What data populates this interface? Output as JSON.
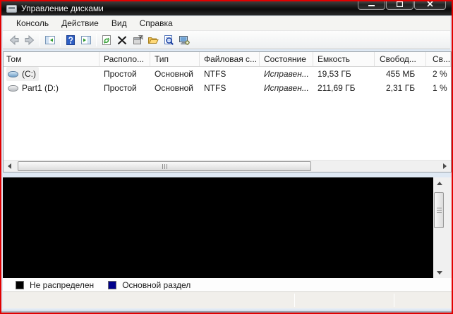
{
  "window": {
    "title": "Управление дисками",
    "border_color": "#e10000"
  },
  "menubar": {
    "items": [
      "Консоль",
      "Действие",
      "Вид",
      "Справка"
    ]
  },
  "toolbar": {
    "icons": [
      "back-icon",
      "forward-icon",
      "show-console-tree-icon",
      "help-icon",
      "show-action-pane-icon",
      "refresh-icon",
      "delete-icon",
      "properties-icon",
      "open-folder-icon",
      "search-icon",
      "manage-computer-icon"
    ]
  },
  "volume_list": {
    "columns": [
      "Том",
      "Располо...",
      "Тип",
      "Файловая с...",
      "Состояние",
      "Емкость",
      "Свобод...",
      "Св..."
    ],
    "rows": [
      {
        "volume": "(C:)",
        "location": "Простой",
        "type": "Основной",
        "filesystem": "NTFS",
        "status": "Исправен...",
        "capacity": "19,53 ГБ",
        "free": "455 МБ",
        "free_pct": "2 %"
      },
      {
        "volume": "Part1 (D:)",
        "location": "Простой",
        "type": "Основной",
        "filesystem": "NTFS",
        "status": "Исправен...",
        "capacity": "211,69 ГБ",
        "free": "2,31 ГБ",
        "free_pct": "1 %"
      }
    ]
  },
  "legend": [
    {
      "label": "Не распределен",
      "color": "#000000"
    },
    {
      "label": "Основной раздел",
      "color": "#00008b"
    }
  ]
}
